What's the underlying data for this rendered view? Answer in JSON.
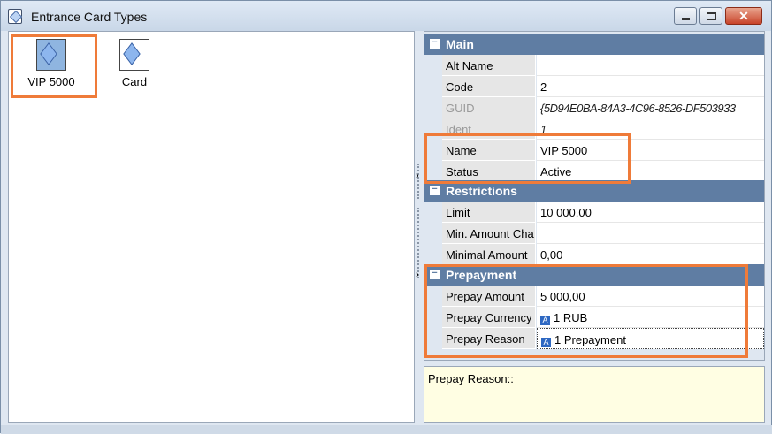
{
  "window": {
    "title": "Entrance Card Types"
  },
  "tiles": [
    {
      "label": "VIP 5000",
      "selected": true
    },
    {
      "label": "Card",
      "selected": false
    }
  ],
  "properties": {
    "main": {
      "title": "Main",
      "rows": [
        {
          "name": "Alt Name",
          "value": ""
        },
        {
          "name": "Code",
          "value": "2"
        },
        {
          "name": "GUID",
          "value": "{5D94E0BA-84A3-4C96-8526-DF503933"
        },
        {
          "name": "Ident",
          "value": "1"
        },
        {
          "name": "Name",
          "value": "VIP 5000"
        },
        {
          "name": "Status",
          "value": "Active"
        }
      ]
    },
    "restrictions": {
      "title": "Restrictions",
      "rows": [
        {
          "name": "Limit",
          "value": "10 000,00"
        },
        {
          "name": "Min. Amount Cha",
          "value": ""
        },
        {
          "name": "Minimal Amount",
          "value": "0,00"
        }
      ]
    },
    "prepayment": {
      "title": "Prepayment",
      "rows": [
        {
          "name": "Prepay Amount",
          "value": "5 000,00"
        },
        {
          "name": "Prepay Currency",
          "value": "1 RUB"
        },
        {
          "name": "Prepay Reason",
          "value": "1 Prepayment"
        }
      ]
    }
  },
  "description": {
    "text": "Prepay Reason::"
  },
  "icons": {
    "expander": "−",
    "ref_tag": "A",
    "splitter_arrow": "›",
    "close": "✕"
  }
}
